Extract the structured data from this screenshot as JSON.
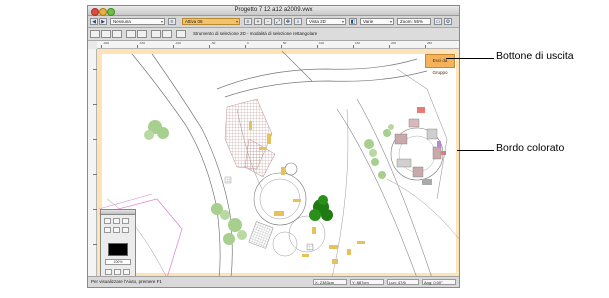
{
  "window": {
    "title": "Progetto 7 12 a12 a2009.vwx"
  },
  "toolbar": {
    "class_field": "Nessuna",
    "layer_field": "Attiva 06",
    "view_field": "Vista 2D",
    "zoom_field": "Varie",
    "zoom_value": "Zoom: 55%"
  },
  "mode_bar": {
    "help_text": "Strumento di selezione 2D - modalità di selezione rettangolare"
  },
  "canvas": {
    "exit_button_label": "Esci da Gruppo"
  },
  "ruler_labels": [
    "-200",
    "-150",
    "-100",
    "-50",
    "0",
    "50",
    "100",
    "150",
    "200",
    "250"
  ],
  "status_bar": {
    "message": "Per visualizzare l'Aiuto, premere F1",
    "field_x": "X: 2383cm",
    "field_y": "Y: 887cm",
    "field_l": "Lun: 47/6",
    "field_a": "Ang: 0.00°"
  },
  "attributes_palette": {
    "value": "100%"
  },
  "callouts": {
    "exit_button": "Bottone di uscita",
    "colored_border": "Bordo colorato"
  },
  "colors": {
    "border": "#fde3b5",
    "exit_button": "#f4b25c",
    "dark_tree": "#1f7a12",
    "light_trees": "#a7cf8d",
    "pink_paving": "#b98f8f"
  }
}
